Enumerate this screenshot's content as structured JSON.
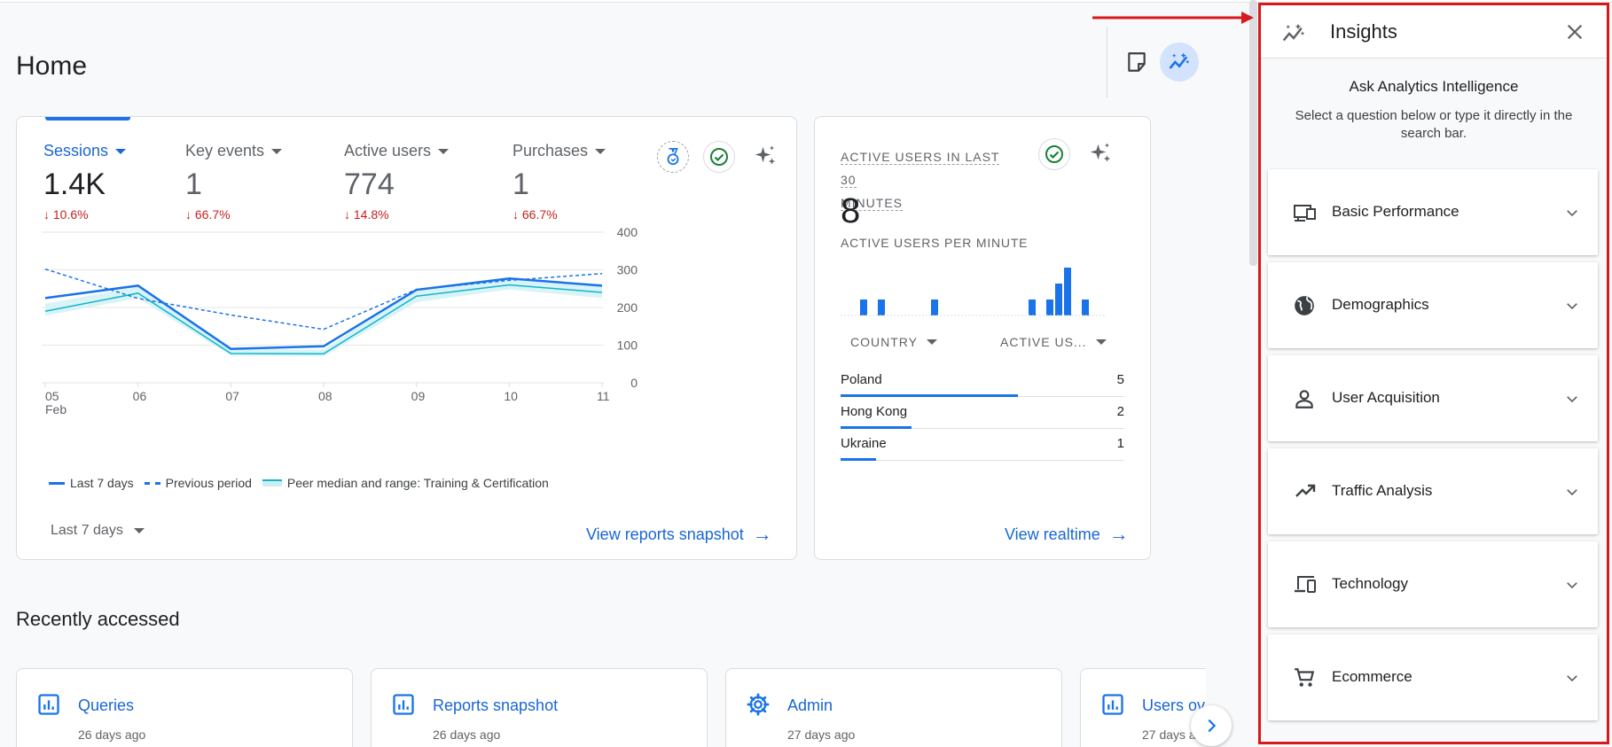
{
  "page": {
    "title": "Home"
  },
  "summary": {
    "metrics": [
      {
        "label": "Sessions",
        "value": "1.4K",
        "delta": "10.6%"
      },
      {
        "label": "Key events",
        "value": "1",
        "delta": "66.7%"
      },
      {
        "label": "Active users",
        "value": "774",
        "delta": "14.8%"
      },
      {
        "label": "Purchases",
        "value": "1",
        "delta": "66.7%"
      }
    ],
    "legend": {
      "last": "Last 7 days",
      "previous": "Previous period",
      "peer": "Peer median and range: Training & Certification"
    },
    "date_range": "Last 7 days",
    "view_link": "View reports snapshot"
  },
  "chart_data": {
    "type": "line",
    "x": [
      "05",
      "06",
      "07",
      "08",
      "09",
      "10",
      "11"
    ],
    "x_sublabel": "Feb",
    "y_ticks": [
      0,
      100,
      200,
      300,
      400
    ],
    "ylim": [
      0,
      400
    ],
    "series": [
      {
        "name": "Last 7 days",
        "values": [
          225,
          258,
          90,
          97,
          247,
          277,
          258
        ]
      },
      {
        "name": "Previous period",
        "values": [
          302,
          224,
          180,
          142,
          248,
          272,
          290
        ]
      },
      {
        "name": "Peer median and range: Training & Certification",
        "values": [
          190,
          238,
          78,
          77,
          230,
          260,
          240
        ],
        "range_low": [
          178,
          225,
          72,
          70,
          214,
          248,
          225
        ],
        "range_high": [
          210,
          255,
          90,
          88,
          250,
          275,
          262
        ]
      }
    ]
  },
  "realtime": {
    "title_line1": "ACTIVE USERS IN LAST 30",
    "title_line2": "MINUTES",
    "value": "8",
    "per_minute_label": "ACTIVE USERS PER MINUTE",
    "per_minute": [
      0,
      0,
      1,
      0,
      1,
      0,
      0,
      0,
      0,
      0,
      1,
      0,
      0,
      0,
      0,
      0,
      0,
      0,
      0,
      0,
      0,
      1,
      0,
      1,
      2,
      3,
      0,
      1,
      0,
      0
    ],
    "country_header": "COUNTRY",
    "active_header": "ACTIVE US...",
    "rows": [
      {
        "country": "Poland",
        "value": "5",
        "share": 1.0
      },
      {
        "country": "Hong Kong",
        "value": "2",
        "share": 0.4
      },
      {
        "country": "Ukraine",
        "value": "1",
        "share": 0.2
      }
    ],
    "view_link": "View realtime"
  },
  "recent": {
    "title": "Recently accessed",
    "items": [
      {
        "label": "Queries",
        "time": "26 days ago",
        "icon": "report-icon"
      },
      {
        "label": "Reports snapshot",
        "time": "26 days ago",
        "icon": "report-icon"
      },
      {
        "label": "Admin",
        "time": "27 days ago",
        "icon": "gear-icon"
      },
      {
        "label": "Users ov",
        "time": "27 days a",
        "icon": "report-icon"
      }
    ]
  },
  "insights": {
    "title": "Insights",
    "ask_title": "Ask Analytics Intelligence",
    "ask_subtitle": "Select a question below or type it directly in the search bar.",
    "categories": [
      {
        "label": "Basic Performance",
        "icon": "performance-icon"
      },
      {
        "label": "Demographics",
        "icon": "globe-icon"
      },
      {
        "label": "User Acquisition",
        "icon": "person-icon"
      },
      {
        "label": "Traffic Analysis",
        "icon": "trending-icon"
      },
      {
        "label": "Technology",
        "icon": "devices-icon"
      },
      {
        "label": "Ecommerce",
        "icon": "cart-icon"
      }
    ]
  },
  "colors": {
    "accent": "#1a73e8",
    "decline": "#c5221f",
    "peer": "#12b5cb",
    "highlight": "#d7191c"
  }
}
